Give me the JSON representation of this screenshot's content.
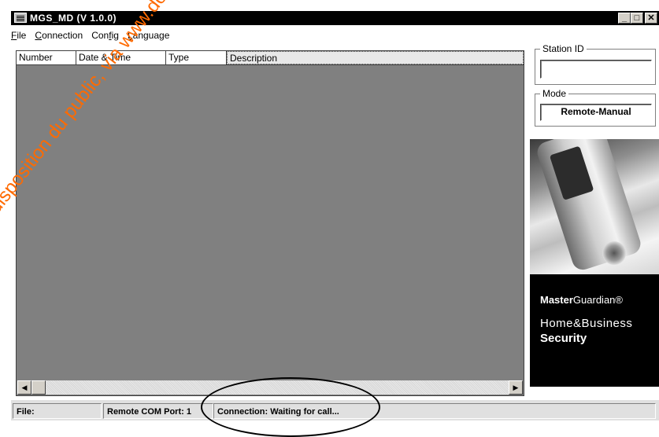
{
  "window": {
    "title": "MGS_MD (V 1.0.0)",
    "min_label": "_",
    "max_label": "□",
    "close_label": "✕",
    "icon": "app-icon"
  },
  "menu": [
    {
      "label": "File",
      "accel": "F"
    },
    {
      "label": "Connection",
      "accel": "C"
    },
    {
      "label": "Config",
      "accel": "f"
    },
    {
      "label": "Language",
      "accel": "L"
    }
  ],
  "list": {
    "columns": [
      "Number",
      "Date & Time",
      "Type",
      "Description"
    ],
    "rows": []
  },
  "scroll": {
    "left_arrow": "◀",
    "right_arrow": "▶"
  },
  "station": {
    "label": "Station ID",
    "value": ""
  },
  "mode": {
    "label": "Mode",
    "value": "Remote-Manual"
  },
  "promo": {
    "brand_bold": "Master",
    "brand_rest": "Guardian®",
    "tagline1": "Home&Business",
    "tagline2": "Security"
  },
  "status": {
    "file": "File:",
    "port": "Remote COM Port: 1",
    "connection": "Connection: Waiting for call..."
  },
  "watermark": "disposition du public, via www.docalarme.com"
}
